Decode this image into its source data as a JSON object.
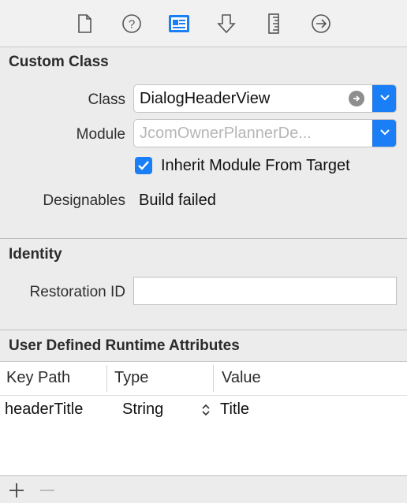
{
  "toolbar": {
    "icons": [
      "file-inspector-icon",
      "quick-help-icon",
      "identity-inspector-icon",
      "attributes-inspector-icon",
      "size-inspector-icon",
      "connections-inspector-icon"
    ],
    "active_color": "#1a7ef7"
  },
  "custom_class": {
    "title": "Custom Class",
    "class_label": "Class",
    "class_value": "DialogHeaderView",
    "module_label": "Module",
    "module_value": "JcomOwnerPlannerDe...",
    "inherit_label": "Inherit Module From Target",
    "inherit_checked": true,
    "designables_label": "Designables",
    "designables_value": "Build failed"
  },
  "identity": {
    "title": "Identity",
    "restoration_label": "Restoration ID",
    "restoration_value": ""
  },
  "runtime_attributes": {
    "title": "User Defined Runtime Attributes",
    "columns": [
      "Key Path",
      "Type",
      "Value"
    ],
    "rows": [
      {
        "key_path": "headerTitle",
        "type": "String",
        "value": "Title"
      }
    ]
  },
  "bottom_bar": {
    "add_icon": "plus-icon",
    "remove_icon": "minus-icon"
  }
}
